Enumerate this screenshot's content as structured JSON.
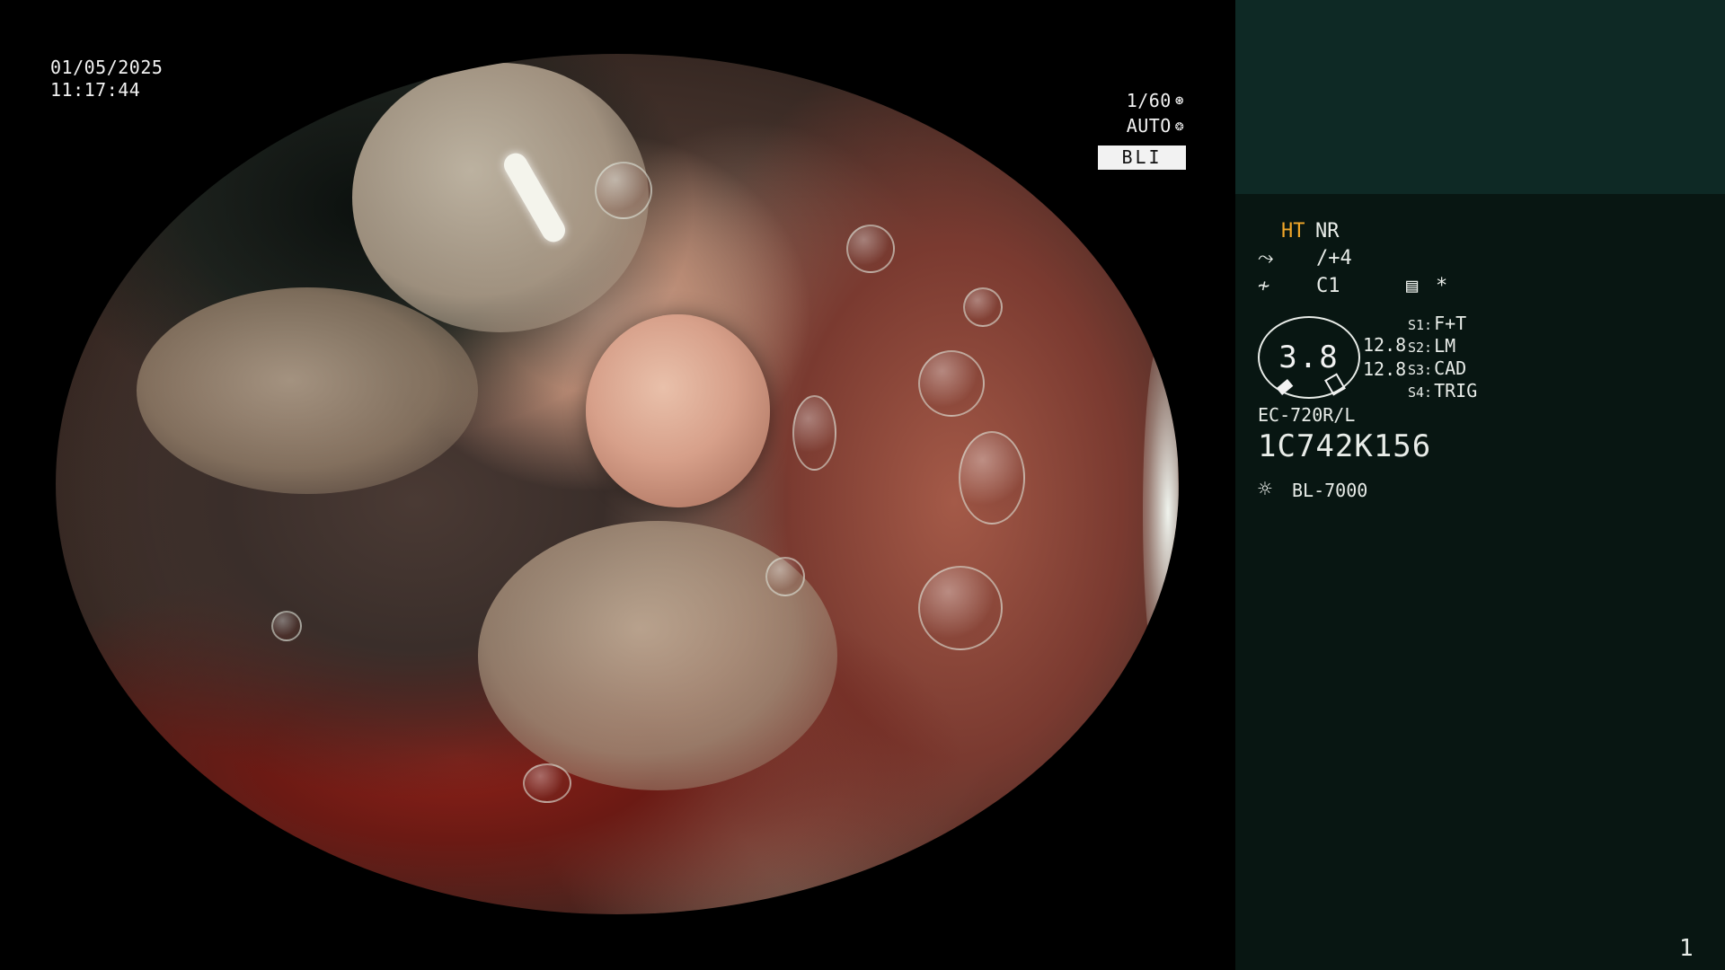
{
  "overlay": {
    "date": "01/05/2025",
    "time": "11:17:44",
    "shutter": "1/60",
    "shutter_icon": "shutter-icon",
    "iris": "AUTO",
    "iris_icon": "iris-icon",
    "mode": "BLI"
  },
  "panel": {
    "ht": "HT",
    "nr": "NR",
    "contrast_icon": "contrast-curve-icon",
    "contrast_value": "/+4",
    "color_icon": "color-tone-icon",
    "color_value": "C1",
    "memo_icon": "memo-icon",
    "star": "*",
    "zoom_value": "3.8",
    "zoom_num1": "12.8",
    "zoom_num2": "12.8",
    "switches": [
      {
        "key": "S1:",
        "value": "F+T"
      },
      {
        "key": "S2:",
        "value": "LM"
      },
      {
        "key": "S3:",
        "value": "CAD"
      },
      {
        "key": "S4:",
        "value": "TRIG"
      }
    ],
    "scope_model": "EC-720R/L",
    "scope_serial": "1C742K156",
    "light_icon": "light-source-icon",
    "light_model": "BL-7000",
    "page": "1"
  },
  "colors": {
    "panel_bg": "#081612",
    "panel_top_bg": "#0e2925",
    "ht_accent": "#f0a629",
    "text": "#e8ece8"
  }
}
